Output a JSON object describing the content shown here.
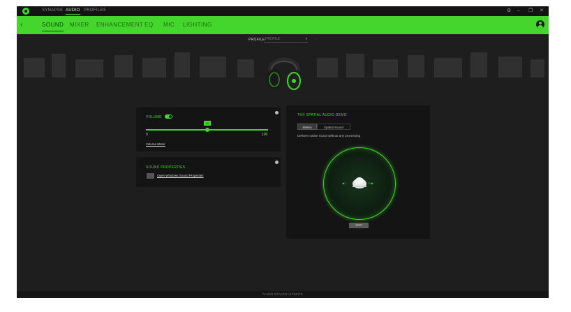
{
  "colors": {
    "accent": "#44d62c",
    "background": "#1e1e1e",
    "panel": "#141414"
  },
  "titlebar": {
    "logo_icon": "razer-logo-icon",
    "tabs": [
      {
        "label": "SYNAPSE",
        "active": false
      },
      {
        "label": "AUDIO",
        "active": true
      },
      {
        "label": "PROFILES",
        "active": false
      }
    ],
    "controls": {
      "settings": "⚙",
      "minimize": "–",
      "maximize": "❐",
      "close": "✕"
    }
  },
  "navbar": {
    "back_icon": "chevron-left-icon",
    "back_glyph": "‹",
    "items": [
      {
        "label": "SOUND",
        "active": true
      },
      {
        "label": "MIXER",
        "active": false
      },
      {
        "label": "ENHANCEMENT",
        "active": false
      },
      {
        "label": "EQ",
        "active": false
      },
      {
        "label": "MIC",
        "active": false
      },
      {
        "label": "LIGHTING",
        "active": false
      }
    ],
    "account_icon": "user-avatar-icon"
  },
  "profile": {
    "label": "PROFILE",
    "value": "PROFILE",
    "caret": "▾",
    "more": "···"
  },
  "device": {
    "caption": ""
  },
  "volume": {
    "label": "VOLUME",
    "enabled": true,
    "value": 50,
    "value_label": "50",
    "min_label": "0",
    "max_label": "100",
    "link": "Volume Meter"
  },
  "sound_properties": {
    "title": "SOUND PROPERTIES",
    "link": "Open Windows Sound Properties"
  },
  "thx": {
    "title": "THX SPATIAL AUDIO DEMO",
    "modes": [
      {
        "label": "Stereo",
        "active": true
      },
      {
        "label": "Spatial Sound",
        "active": false
      }
    ],
    "description": "Delivers native sound without any processing",
    "left_mark": "◀ L",
    "right_mark": "R ▶",
    "test_label": "TEST"
  },
  "statusbar": {
    "text": "RAZER KRAKEN ULTIMATE"
  }
}
